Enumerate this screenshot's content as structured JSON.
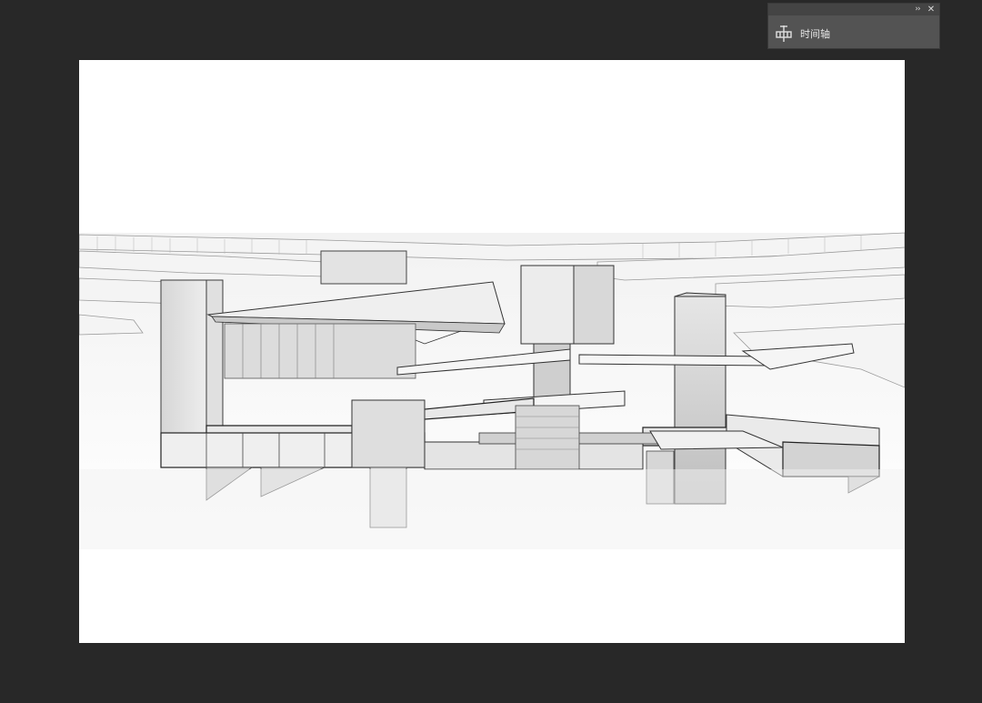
{
  "panel": {
    "collapse_label": "››",
    "close_label": "✕",
    "timeline_label": "时间轴",
    "timeline_icon": "timeline-icon"
  },
  "canvas": {
    "image_icon": "architectural-section-render"
  },
  "colors": {
    "workspace_bg": "#282828",
    "panel_bg": "#535353",
    "panel_header": "#444444",
    "canvas_bg": "#ffffff"
  }
}
